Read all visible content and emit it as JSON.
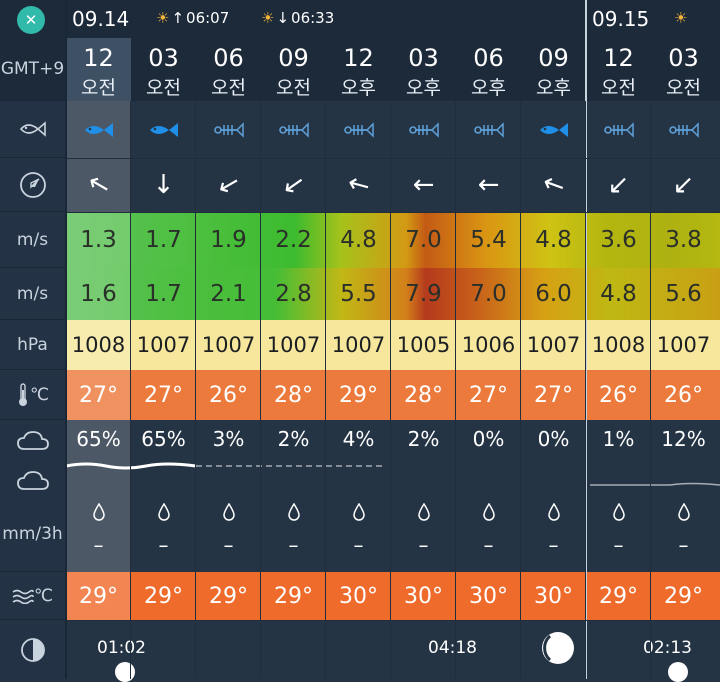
{
  "left": {
    "timezone": "GMT+9",
    "wind_unit": "m/s",
    "gust_unit": "m/s",
    "pressure_unit": "hPa",
    "air_temp_icon": "thermometer-icon",
    "air_temp_unit": "℃",
    "precip_unit": "mm/3h",
    "sea_temp_unit": "℃",
    "icons": [
      "fish-icon",
      "compass-icon",
      "cloud-icon",
      "rain-cloud-icon",
      "waves-icon",
      "moon-phase-icon"
    ]
  },
  "dates": [
    {
      "date": "09.14",
      "sunrise": "06:07",
      "sunset": "06:33"
    },
    {
      "date": "09.15"
    }
  ],
  "hours": [
    {
      "h": "12",
      "ap": "오전"
    },
    {
      "h": "03",
      "ap": "오전"
    },
    {
      "h": "06",
      "ap": "오전"
    },
    {
      "h": "09",
      "ap": "오전"
    },
    {
      "h": "12",
      "ap": "오후"
    },
    {
      "h": "03",
      "ap": "오후"
    },
    {
      "h": "06",
      "ap": "오후"
    },
    {
      "h": "09",
      "ap": "오후"
    },
    {
      "h": "12",
      "ap": "오전"
    },
    {
      "h": "03",
      "ap": "오전"
    }
  ],
  "fishing": [
    "fish-solid",
    "fish-solid",
    "fish-bone",
    "fish-bone",
    "fish-bone",
    "fish-bone",
    "fish-bone",
    "fish-solid",
    "fish-bone",
    "fish-bone"
  ],
  "wind_dir": [
    "←",
    "↓",
    "↙",
    "↙",
    "←",
    "←",
    "←",
    "←",
    "↙",
    "↙"
  ],
  "wind_dir_deg": [
    30,
    0,
    15,
    10,
    15,
    0,
    0,
    20,
    0,
    0
  ],
  "wind": [
    "1.3",
    "1.7",
    "1.9",
    "2.2",
    "4.8",
    "7.0",
    "5.4",
    "4.8",
    "3.6",
    "3.8"
  ],
  "gust": [
    "1.6",
    "1.7",
    "2.1",
    "2.8",
    "5.5",
    "7.9",
    "7.0",
    "6.0",
    "4.8",
    "5.6"
  ],
  "pressure": [
    "1008",
    "1007",
    "1007",
    "1007",
    "1007",
    "1005",
    "1006",
    "1007",
    "1008",
    "1007"
  ],
  "air_temp": [
    "27°",
    "27°",
    "26°",
    "28°",
    "29°",
    "28°",
    "27°",
    "27°",
    "26°",
    "26°"
  ],
  "cloud": [
    "65%",
    "65%",
    "3%",
    "2%",
    "4%",
    "2%",
    "0%",
    "0%",
    "1%",
    "12%"
  ],
  "precip": [
    "–",
    "–",
    "–",
    "–",
    "–",
    "–",
    "–",
    "–",
    "–",
    "–"
  ],
  "sea_temp": [
    "29°",
    "29°",
    "29°",
    "29°",
    "30°",
    "30°",
    "30°",
    "30°",
    "29°",
    "29°"
  ],
  "moon": [
    {
      "time": "01:02"
    },
    {
      "time": "04:18"
    },
    {
      "time": "02:13"
    }
  ],
  "colors": {
    "background": "#253445",
    "header": "#1d2a39",
    "fish_active": "#1f8fe8",
    "fish_inactive": "#5e9fd6",
    "pressure_band": "#f6e79c",
    "temp_band": "#ec7a3c",
    "sea_band": "#ef6b2c",
    "accent_close": "#31b9a9",
    "sun": "#f5b53a"
  }
}
